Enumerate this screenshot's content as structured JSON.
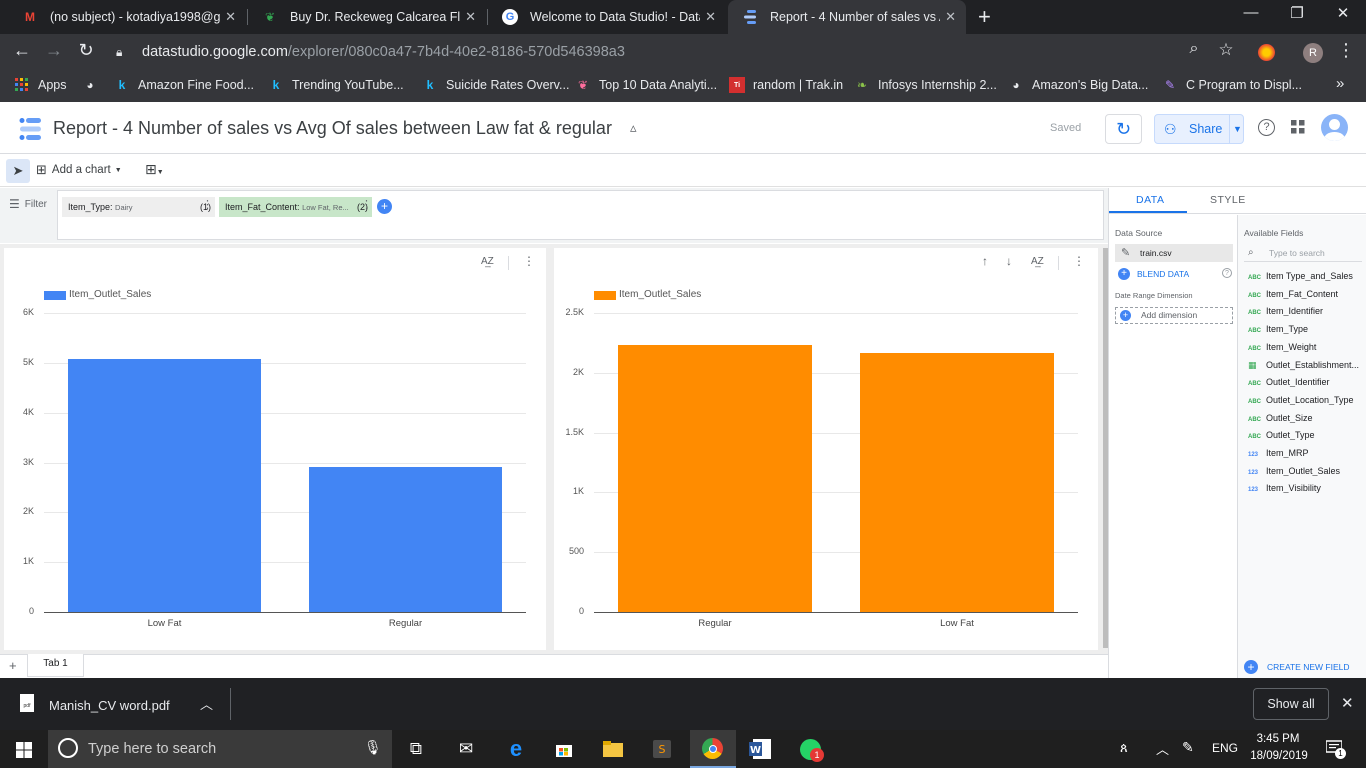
{
  "browser": {
    "tabs": [
      {
        "title": "(no subject) - kotadiya1998@gm",
        "icon": "gmail-icon",
        "active": false
      },
      {
        "title": "Buy Dr. Reckeweg Calcarea Fluori",
        "icon": "leaf-icon",
        "active": false
      },
      {
        "title": "Welcome to Data Studio! - Data S",
        "icon": "google-icon",
        "active": false
      },
      {
        "title": "Report - 4 Number of sales vs Av",
        "icon": "datastudio-icon",
        "active": true
      }
    ],
    "url_host": "datastudio.google.com",
    "url_path": "/explorer/080c0a47-7b4d-40e2-8186-570d546398a3",
    "profile_initial": "R",
    "bookmarks": [
      {
        "label": "Apps",
        "icon": "apps-grid-icon"
      },
      {
        "label": "",
        "icon": "globe-icon"
      },
      {
        "label": "Amazon Fine Food...",
        "icon": "kaggle-icon"
      },
      {
        "label": "Trending YouTube...",
        "icon": "kaggle-icon"
      },
      {
        "label": "Suicide Rates Overv...",
        "icon": "kaggle-icon"
      },
      {
        "label": "Top 10 Data Analyti...",
        "icon": "heart-icon"
      },
      {
        "label": "random | Trak.in",
        "icon": "trakin-icon"
      },
      {
        "label": "Infosys Internship 2...",
        "icon": "bird-icon"
      },
      {
        "label": "Amazon's Big Data...",
        "icon": "globe-icon"
      },
      {
        "label": "C Program to Displ...",
        "icon": "pencil-icon"
      }
    ]
  },
  "app": {
    "title": "Report - 4 Number of sales vs Avg Of sales between Law fat & regular",
    "saved_label": "Saved",
    "share_label": "Share",
    "add_chart_label": "Add a chart",
    "filter_label": "Filter",
    "filters": [
      {
        "name": "Item_Type",
        "value": "Dairy",
        "count": "(1)"
      },
      {
        "name": "Item_Fat_Content",
        "value": "Low Fat, Re...",
        "count": "(2)"
      }
    ],
    "page_tab": "Tab 1"
  },
  "chart_data": [
    {
      "type": "bar",
      "series": [
        {
          "name": "Item_Outlet_Sales",
          "values": [
            5080,
            2900
          ]
        }
      ],
      "categories": [
        "Low Fat",
        "Regular"
      ],
      "ylim": [
        0,
        6000
      ],
      "yticks": [
        "0",
        "1K",
        "2K",
        "3K",
        "4K",
        "5K",
        "6K"
      ],
      "ytick_values": [
        0,
        1000,
        2000,
        3000,
        4000,
        5000,
        6000
      ],
      "color": "#4285f4",
      "legend": "top-left",
      "grid": true
    },
    {
      "type": "bar",
      "series": [
        {
          "name": "Item_Outlet_Sales",
          "values": [
            2230,
            2165
          ]
        }
      ],
      "categories": [
        "Regular",
        "Low Fat"
      ],
      "ylim": [
        0,
        2500
      ],
      "yticks": [
        "0",
        "500",
        "1K",
        "1.5K",
        "2K",
        "2.5K"
      ],
      "ytick_values": [
        0,
        500,
        1000,
        1500,
        2000,
        2500
      ],
      "color": "#ff8c00",
      "legend": "top-left",
      "grid": true
    }
  ],
  "panel": {
    "tab_data": "DATA",
    "tab_style": "STYLE",
    "data_source_label": "Data Source",
    "data_source": "train.csv",
    "blend_label": "BLEND DATA",
    "date_range_label": "Date Range Dimension",
    "add_dimension_label": "Add dimension",
    "available_fields_label": "Available Fields",
    "search_placeholder": "Type to search",
    "fields": [
      {
        "name": "Item Type_and_Sales",
        "type": "ABC"
      },
      {
        "name": "Item_Fat_Content",
        "type": "ABC"
      },
      {
        "name": "Item_Identifier",
        "type": "ABC"
      },
      {
        "name": "Item_Type",
        "type": "ABC"
      },
      {
        "name": "Item_Weight",
        "type": "ABC"
      },
      {
        "name": "Outlet_Establishment...",
        "type": "DATE"
      },
      {
        "name": "Outlet_Identifier",
        "type": "ABC"
      },
      {
        "name": "Outlet_Location_Type",
        "type": "ABC"
      },
      {
        "name": "Outlet_Size",
        "type": "ABC"
      },
      {
        "name": "Outlet_Type",
        "type": "ABC"
      },
      {
        "name": "Item_MRP",
        "type": "123"
      },
      {
        "name": "Item_Outlet_Sales",
        "type": "123"
      },
      {
        "name": "Item_Visibility",
        "type": "123"
      }
    ],
    "create_field_label": "CREATE NEW FIELD"
  },
  "download": {
    "file": "Manish_CV  word.pdf",
    "show_all": "Show all"
  },
  "taskbar": {
    "search_placeholder": "Type here to search",
    "language": "ENG",
    "time": "3:45 PM",
    "date": "18/09/2019",
    "notification_count": "1",
    "whatsapp_badge": "1"
  }
}
